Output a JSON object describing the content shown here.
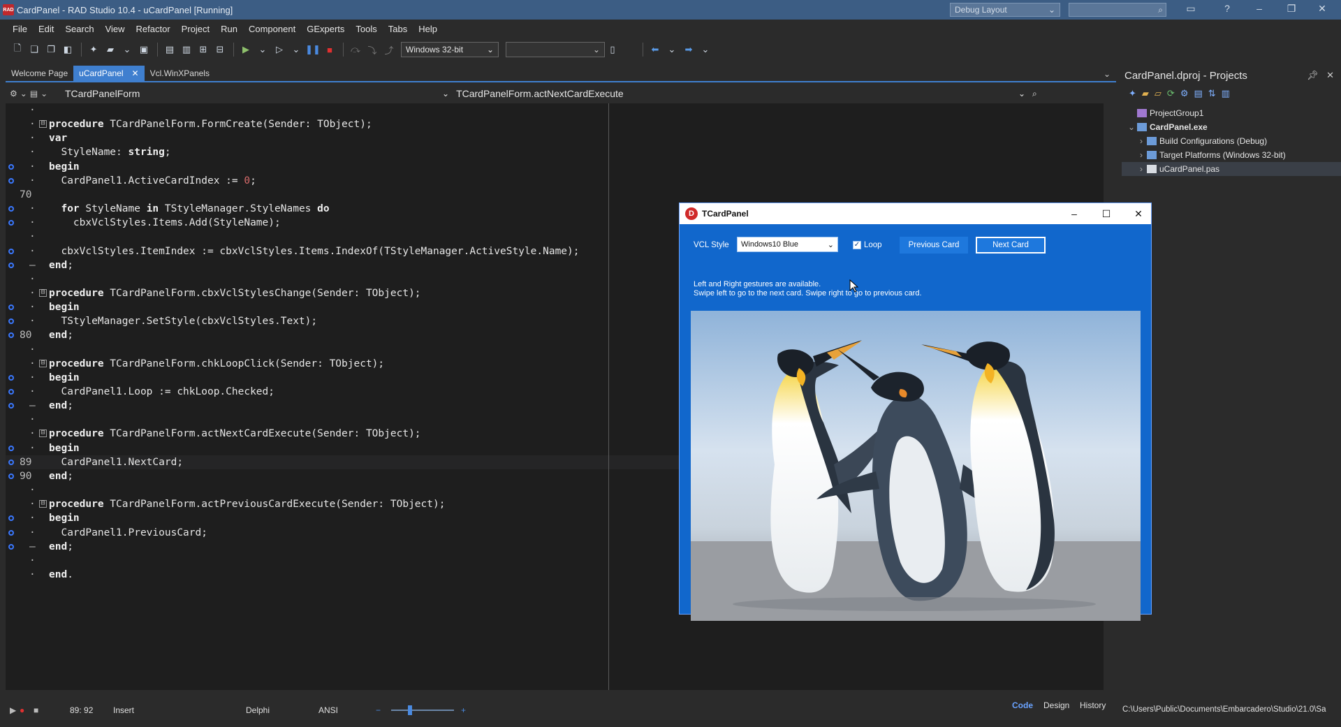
{
  "window": {
    "title": "CardPanel - RAD Studio 10.4 - uCardPanel [Running]",
    "logo_text": "RAD",
    "layout": "Debug Layout"
  },
  "menu": [
    "File",
    "Edit",
    "Search",
    "View",
    "Refactor",
    "Project",
    "Run",
    "Component",
    "GExperts",
    "Tools",
    "Tabs",
    "Help"
  ],
  "toolbar": {
    "platform": "Windows 32-bit"
  },
  "editor_tabs": [
    "Welcome Page",
    "uCardPanel",
    "Vcl.WinXPanels"
  ],
  "editor": {
    "class_name": "TCardPanelForm",
    "method_name": "TCardPanelForm.actNextCardExecute"
  },
  "code_lines": [
    {
      "no": "",
      "dot": "·",
      "text": "",
      "bp": false,
      "fold": ""
    },
    {
      "no": "",
      "dot": "·",
      "text": "procedure TCardPanelForm.FormCreate(Sender: TObject);",
      "bp": false,
      "fold": "⊟"
    },
    {
      "no": "",
      "dot": "·",
      "text": "var",
      "bp": false,
      "fold": ""
    },
    {
      "no": "",
      "dot": "·",
      "text": "  StyleName: string;",
      "bp": false,
      "fold": ""
    },
    {
      "no": "",
      "dot": "·",
      "text": "begin",
      "bp": true,
      "fold": ""
    },
    {
      "no": "",
      "dot": "·",
      "text": "  CardPanel1.ActiveCardIndex := 0;",
      "bp": true,
      "fold": ""
    },
    {
      "no": "70",
      "dot": "",
      "text": "",
      "bp": false,
      "fold": ""
    },
    {
      "no": "",
      "dot": "·",
      "text": "  for StyleName in TStyleManager.StyleNames do",
      "bp": true,
      "fold": ""
    },
    {
      "no": "",
      "dot": "·",
      "text": "    cbxVclStyles.Items.Add(StyleName);",
      "bp": true,
      "fold": ""
    },
    {
      "no": "",
      "dot": "·",
      "text": "",
      "bp": false,
      "fold": ""
    },
    {
      "no": "",
      "dot": "·",
      "text": "  cbxVclStyles.ItemIndex := cbxVclStyles.Items.IndexOf(TStyleManager.ActiveStyle.Name);",
      "bp": true,
      "fold": ""
    },
    {
      "no": "",
      "dot": "–",
      "text": "end;",
      "bp": true,
      "fold": ""
    },
    {
      "no": "",
      "dot": "·",
      "text": "",
      "bp": false,
      "fold": ""
    },
    {
      "no": "",
      "dot": "·",
      "text": "procedure TCardPanelForm.cbxVclStylesChange(Sender: TObject);",
      "bp": false,
      "fold": "⊟"
    },
    {
      "no": "",
      "dot": "·",
      "text": "begin",
      "bp": true,
      "fold": ""
    },
    {
      "no": "",
      "dot": "·",
      "text": "  TStyleManager.SetStyle(cbxVclStyles.Text);",
      "bp": true,
      "fold": ""
    },
    {
      "no": "80",
      "dot": "",
      "text": "end;",
      "bp": true,
      "fold": ""
    },
    {
      "no": "",
      "dot": "·",
      "text": "",
      "bp": false,
      "fold": ""
    },
    {
      "no": "",
      "dot": "·",
      "text": "procedure TCardPanelForm.chkLoopClick(Sender: TObject);",
      "bp": false,
      "fold": "⊟"
    },
    {
      "no": "",
      "dot": "·",
      "text": "begin",
      "bp": true,
      "fold": ""
    },
    {
      "no": "",
      "dot": "·",
      "text": "  CardPanel1.Loop := chkLoop.Checked;",
      "bp": true,
      "fold": ""
    },
    {
      "no": "",
      "dot": "–",
      "text": "end;",
      "bp": true,
      "fold": ""
    },
    {
      "no": "",
      "dot": "·",
      "text": "",
      "bp": false,
      "fold": ""
    },
    {
      "no": "",
      "dot": "·",
      "text": "procedure TCardPanelForm.actNextCardExecute(Sender: TObject);",
      "bp": false,
      "fold": "⊟"
    },
    {
      "no": "",
      "dot": "·",
      "text": "begin",
      "bp": true,
      "fold": ""
    },
    {
      "no": "89",
      "dot": "",
      "text": "  CardPanel1.NextCard;",
      "bp": true,
      "fold": "",
      "current": true
    },
    {
      "no": "90",
      "dot": "",
      "text": "end;",
      "bp": true,
      "fold": ""
    },
    {
      "no": "",
      "dot": "·",
      "text": "",
      "bp": false,
      "fold": ""
    },
    {
      "no": "",
      "dot": "·",
      "text": "procedure TCardPanelForm.actPreviousCardExecute(Sender: TObject);",
      "bp": false,
      "fold": "⊟"
    },
    {
      "no": "",
      "dot": "·",
      "text": "begin",
      "bp": true,
      "fold": ""
    },
    {
      "no": "",
      "dot": "·",
      "text": "  CardPanel1.PreviousCard;",
      "bp": true,
      "fold": ""
    },
    {
      "no": "",
      "dot": "–",
      "text": "end;",
      "bp": true,
      "fold": ""
    },
    {
      "no": "",
      "dot": "·",
      "text": "",
      "bp": false,
      "fold": ""
    },
    {
      "no": "",
      "dot": "·",
      "text": "end.",
      "bp": false,
      "fold": ""
    }
  ],
  "status": {
    "position": "89: 92",
    "mode": "Insert",
    "language": "Delphi",
    "encoding": "ANSI",
    "zoom_level": 0.3
  },
  "view_tabs": [
    "Code",
    "Design",
    "History"
  ],
  "projects": {
    "title": "CardPanel.dproj - Projects",
    "tree": [
      {
        "label": "ProjectGroup1",
        "level": 0,
        "bold": false,
        "selected": false,
        "twisty": ""
      },
      {
        "label": "CardPanel.exe",
        "level": 0,
        "bold": true,
        "selected": false,
        "twisty": "⌄"
      },
      {
        "label": "Build Configurations (Debug)",
        "level": 1,
        "bold": false,
        "selected": false,
        "twisty": "›"
      },
      {
        "label": "Target Platforms (Windows 32-bit)",
        "level": 1,
        "bold": false,
        "selected": false,
        "twisty": "›"
      },
      {
        "label": "uCardPanel.pas",
        "level": 1,
        "bold": false,
        "selected": true,
        "twisty": "›"
      }
    ],
    "path": "C:\\Users\\Public\\Documents\\Embarcadero\\Studio\\21.0\\Sa"
  },
  "app": {
    "title": "TCardPanel",
    "logo_letter": "D",
    "vcl_style_label": "VCL Style",
    "vcl_style_value": "Windows10 Blue",
    "loop_label": "Loop",
    "loop_checked": true,
    "prev_button": "Previous Card",
    "next_button": "Next Card",
    "info_line1": "Left and Right gestures are available.",
    "info_line2": "Swipe left to go to the next card. Swipe right to go to previous card."
  },
  "colors": {
    "accent": "#3f7fcf",
    "app_background": "#1167cc",
    "editor_background": "#1e1e1e"
  }
}
